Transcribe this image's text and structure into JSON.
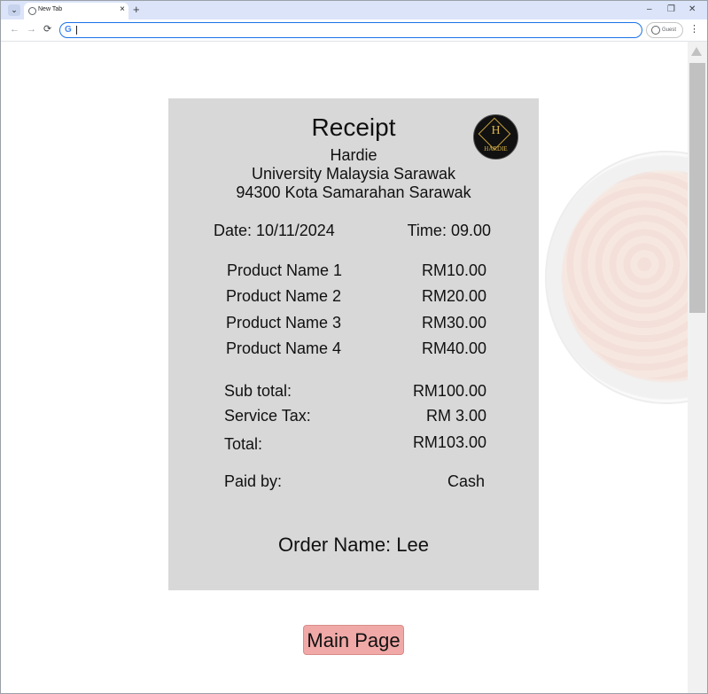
{
  "browser": {
    "tab_title": "New Tab",
    "tab_close": "×",
    "new_tab": "+",
    "window_controls": [
      "–",
      "❐",
      "✕"
    ],
    "nav": [
      "←",
      "→",
      "⟳"
    ],
    "address_icon": "G",
    "address_value": "",
    "profile_label": "Guest",
    "menu": "⋮"
  },
  "receipt": {
    "title": "Receipt",
    "store_name": "Hardie",
    "address_line1": "University Malaysia Sarawak",
    "address_line2": "94300 Kota Samarahan Sarawak",
    "logo_letter": "H",
    "logo_text": "HARDIE",
    "date": "Date: 10/11/2024",
    "time": "Time: 09.00",
    "items": [
      {
        "name": "Product Name 1",
        "price": "RM10.00"
      },
      {
        "name": "Product Name 2",
        "price": "RM20.00"
      },
      {
        "name": "Product Name 3",
        "price": "RM30.00"
      },
      {
        "name": "Product Name 4",
        "price": "RM40.00"
      }
    ],
    "subtotal_label": "Sub total:",
    "subtotal_value": "RM100.00",
    "tax_label": "Service Tax:",
    "tax_value": "RM 3.00",
    "total_label": "Total:",
    "total_value": "RM103.00",
    "paid_label": "Paid by:",
    "paid_value": "Cash",
    "order_name": "Order Name: Lee"
  },
  "main_button_label": "Main Page"
}
